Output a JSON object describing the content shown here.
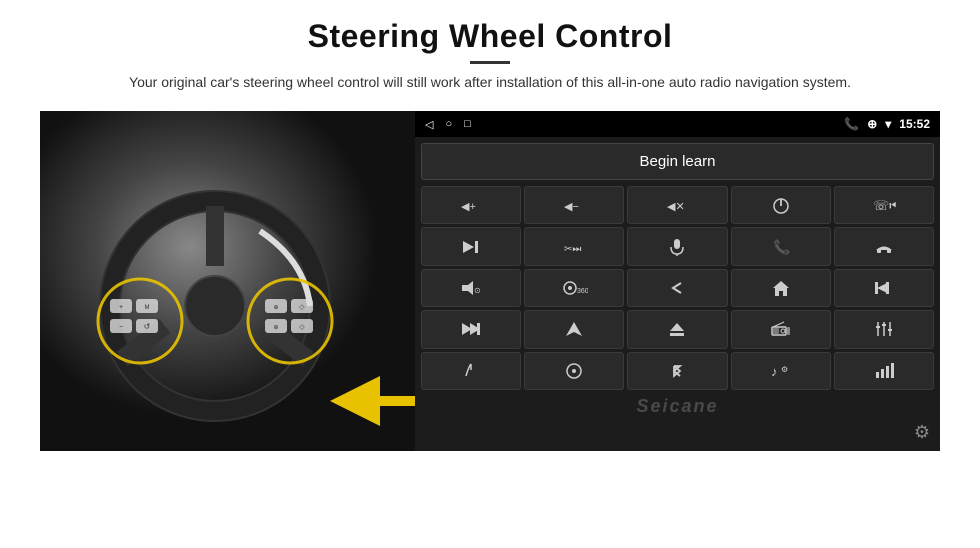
{
  "header": {
    "title": "Steering Wheel Control",
    "subtitle": "Your original car's steering wheel control will still work after installation of this all-in-one auto radio navigation system."
  },
  "statusbar": {
    "left_icons": [
      "◁",
      "○",
      "□"
    ],
    "signal": "▮▮",
    "time": "15:52"
  },
  "begin_learn_label": "Begin learn",
  "icons": [
    {
      "symbol": "🔊+",
      "name": "vol-up"
    },
    {
      "symbol": "🔊−",
      "name": "vol-down"
    },
    {
      "symbol": "🔇",
      "name": "mute"
    },
    {
      "symbol": "⏻",
      "name": "power"
    },
    {
      "symbol": "⏮",
      "name": "prev-track-2"
    },
    {
      "symbol": "⏭",
      "name": "next-track"
    },
    {
      "symbol": "✂⏭",
      "name": "seek-fwd"
    },
    {
      "symbol": "🎤",
      "name": "mic"
    },
    {
      "symbol": "📞",
      "name": "call"
    },
    {
      "symbol": "↩",
      "name": "hang-up"
    },
    {
      "symbol": "📢",
      "name": "sound"
    },
    {
      "symbol": "360°",
      "name": "360-cam"
    },
    {
      "symbol": "↩",
      "name": "back"
    },
    {
      "symbol": "⌂",
      "name": "home"
    },
    {
      "symbol": "⏮⏮",
      "name": "rewind"
    },
    {
      "symbol": "⏭",
      "name": "fast-next"
    },
    {
      "symbol": "▲",
      "name": "nav"
    },
    {
      "symbol": "⏏",
      "name": "eject"
    },
    {
      "symbol": "📻",
      "name": "radio"
    },
    {
      "symbol": "⚙",
      "name": "eq"
    },
    {
      "symbol": "✏",
      "name": "learn-pen"
    },
    {
      "symbol": "⊙",
      "name": "menu-circle"
    },
    {
      "symbol": "✳",
      "name": "bluetooth"
    },
    {
      "symbol": "🎵",
      "name": "music"
    },
    {
      "symbol": "📶",
      "name": "signal-bar"
    }
  ],
  "watermark": "Seicane",
  "gear_icon": "⚙"
}
